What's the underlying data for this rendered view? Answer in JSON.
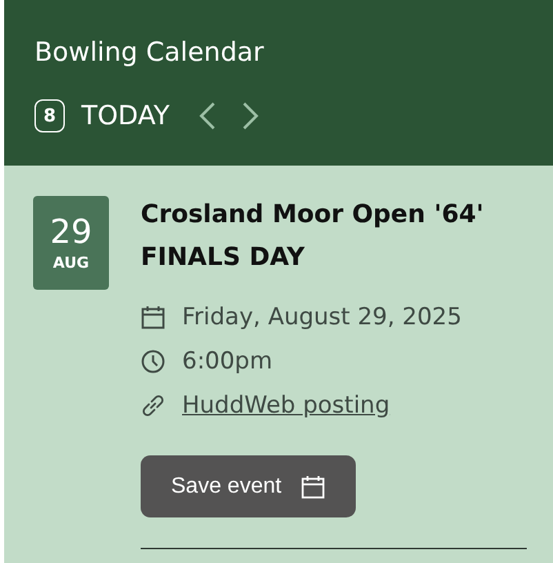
{
  "header": {
    "title": "Bowling Calendar",
    "today_badge": "8",
    "today_label": "TODAY"
  },
  "events": [
    {
      "day": "29",
      "month": "AUG",
      "title": "Crosland Moor Open '64' FINALS DAY",
      "date": "Friday, August 29, 2025",
      "time": "6:00pm",
      "link": "HuddWeb posting",
      "button": "Save event"
    }
  ]
}
